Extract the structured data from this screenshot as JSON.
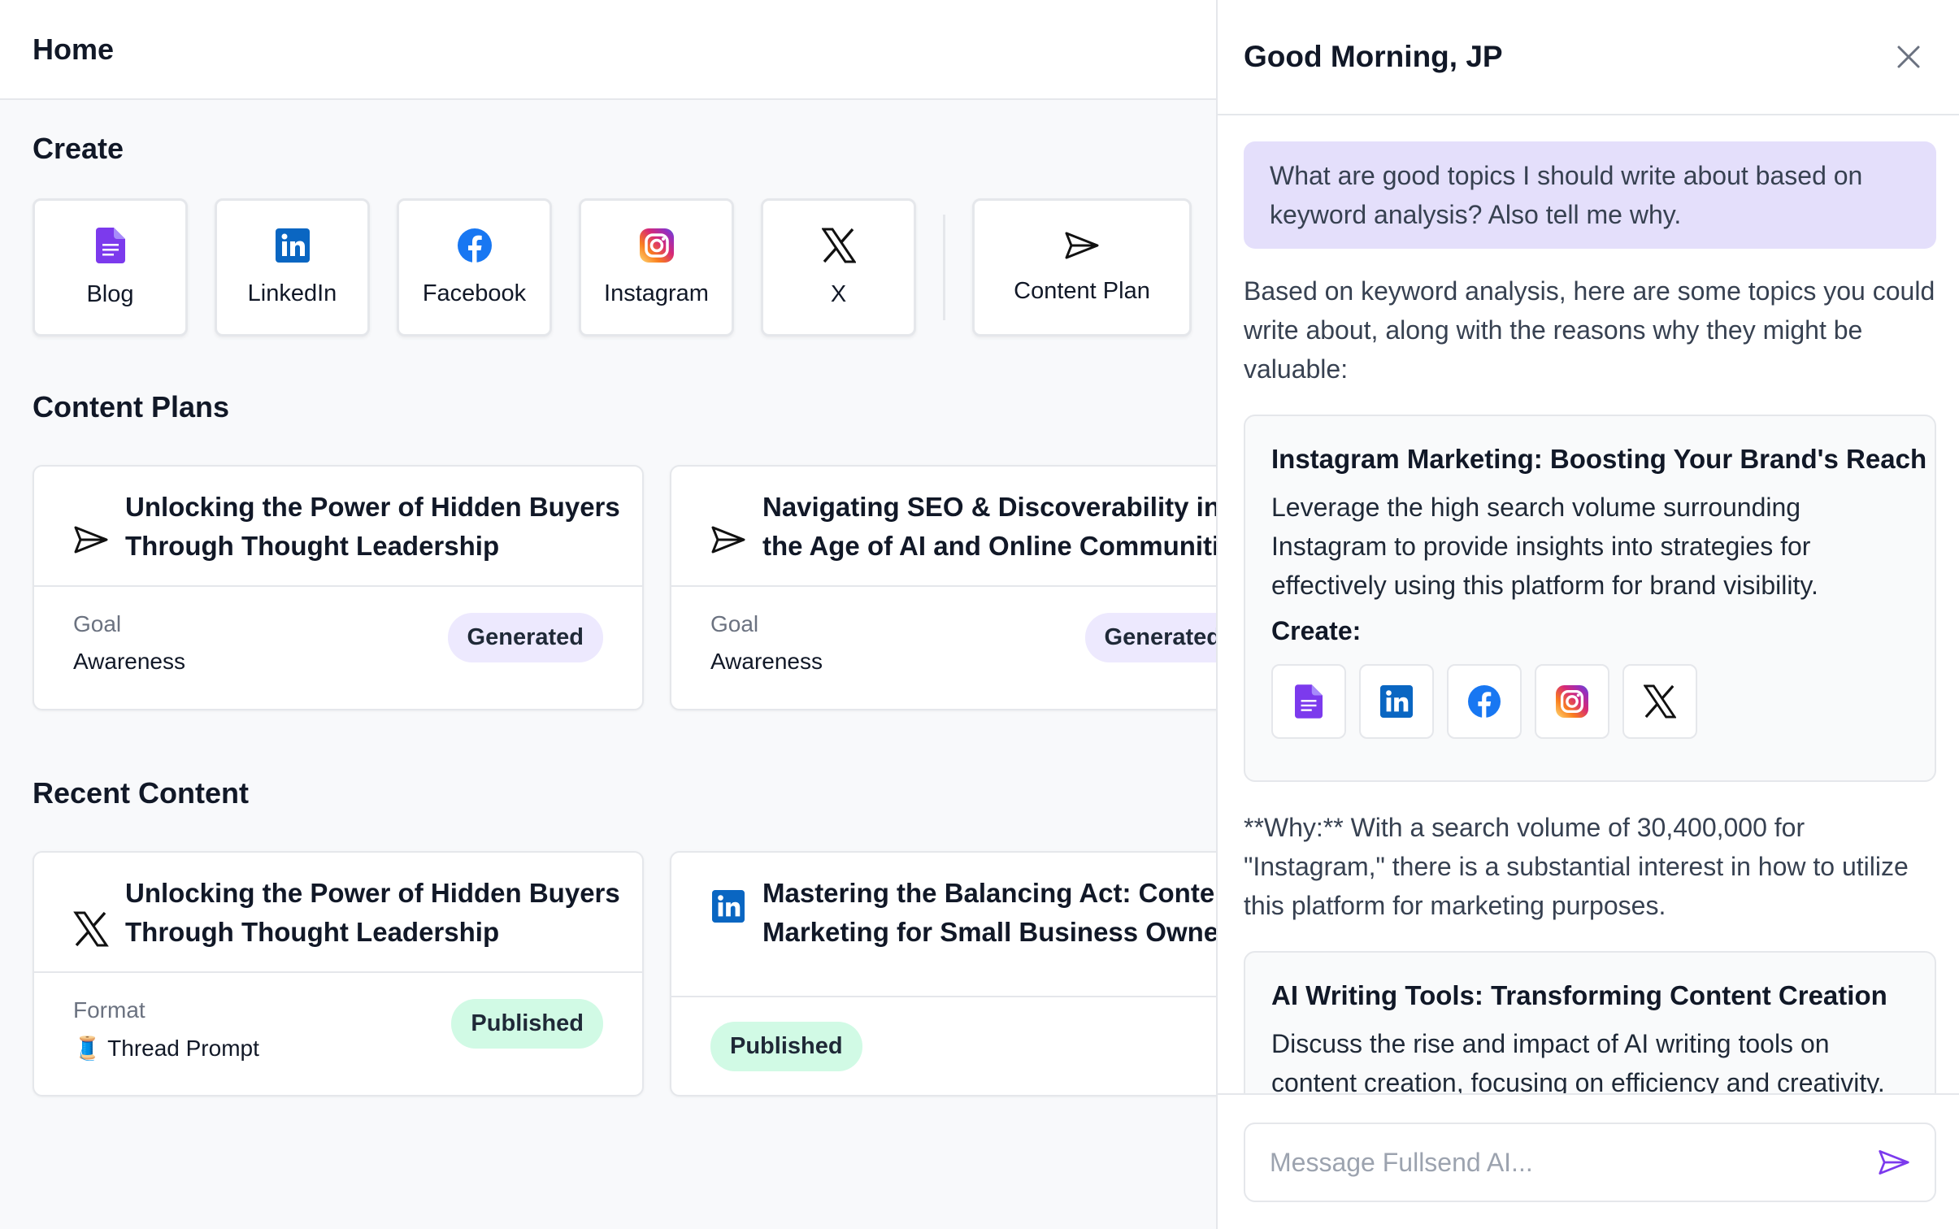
{
  "header": {
    "title": "Home"
  },
  "create": {
    "title": "Create",
    "tiles": [
      {
        "label": "Blog",
        "icon": "document-icon"
      },
      {
        "label": "LinkedIn",
        "icon": "linkedin-icon"
      },
      {
        "label": "Facebook",
        "icon": "facebook-icon"
      },
      {
        "label": "Instagram",
        "icon": "instagram-icon"
      },
      {
        "label": "X",
        "icon": "x-icon"
      },
      {
        "label": "Content Plan",
        "icon": "send-icon"
      }
    ]
  },
  "content_plans": {
    "title": "Content Plans",
    "cards": [
      {
        "title_line1": "Unlocking the Power of Hidden Buyers",
        "title_line2": "Through Thought Leadership",
        "meta_key": "Goal",
        "meta_value": "Awareness",
        "status": "Generated",
        "icon": "send-icon"
      },
      {
        "title_line1": "Navigating SEO & Discoverability in",
        "title_line2": "the Age of AI and Online Communities",
        "meta_key": "Goal",
        "meta_value": "Awareness",
        "status": "Generated",
        "icon": "send-icon"
      }
    ]
  },
  "recent_content": {
    "title": "Recent Content",
    "cards": [
      {
        "title_line1": "Unlocking the Power of Hidden Buyers",
        "title_line2": "Through Thought Leadership",
        "meta_key": "Format",
        "meta_value": "🧵 Thread Prompt",
        "status": "Published",
        "icon": "x-icon"
      },
      {
        "title_line1": "Mastering the Balancing Act: Content",
        "title_line2": "Marketing for Small Business Owners",
        "status": "Published",
        "icon": "linkedin-icon"
      }
    ]
  },
  "chat": {
    "greeting": "Good Morning, JP",
    "user_message": "What are good topics I should write about based on keyword analysis? Also tell me why.",
    "ai_intro": "Based on keyword analysis, here are some topics you could write about, along with the reasons why they might be valuable:",
    "topics": [
      {
        "title": "Instagram Marketing: Boosting Your Brand's Reach",
        "description": "Leverage the high search volume surrounding Instagram to provide insights into strategies for effectively using this platform for brand visibility.",
        "create_label": "Create:"
      },
      {
        "title": "AI Writing Tools: Transforming Content Creation",
        "description": "Discuss the rise and impact of AI writing tools on content creation, focusing on efficiency and creativity."
      }
    ],
    "why_text": "**Why:** With a search volume of 30,400,000 for \"Instagram,\" there is a substantial interest in how to utilize this platform for marketing purposes.",
    "input_placeholder": "Message Fullsend AI..."
  },
  "colors": {
    "accent": "#7c3aed",
    "blog_purple": "#7c3aed",
    "linkedin_blue": "#0a66c2",
    "facebook_blue": "#1877f2",
    "generated_pill": "#ede9fe",
    "published_pill": "#d1fae5",
    "user_bubble": "#e4dffb"
  }
}
